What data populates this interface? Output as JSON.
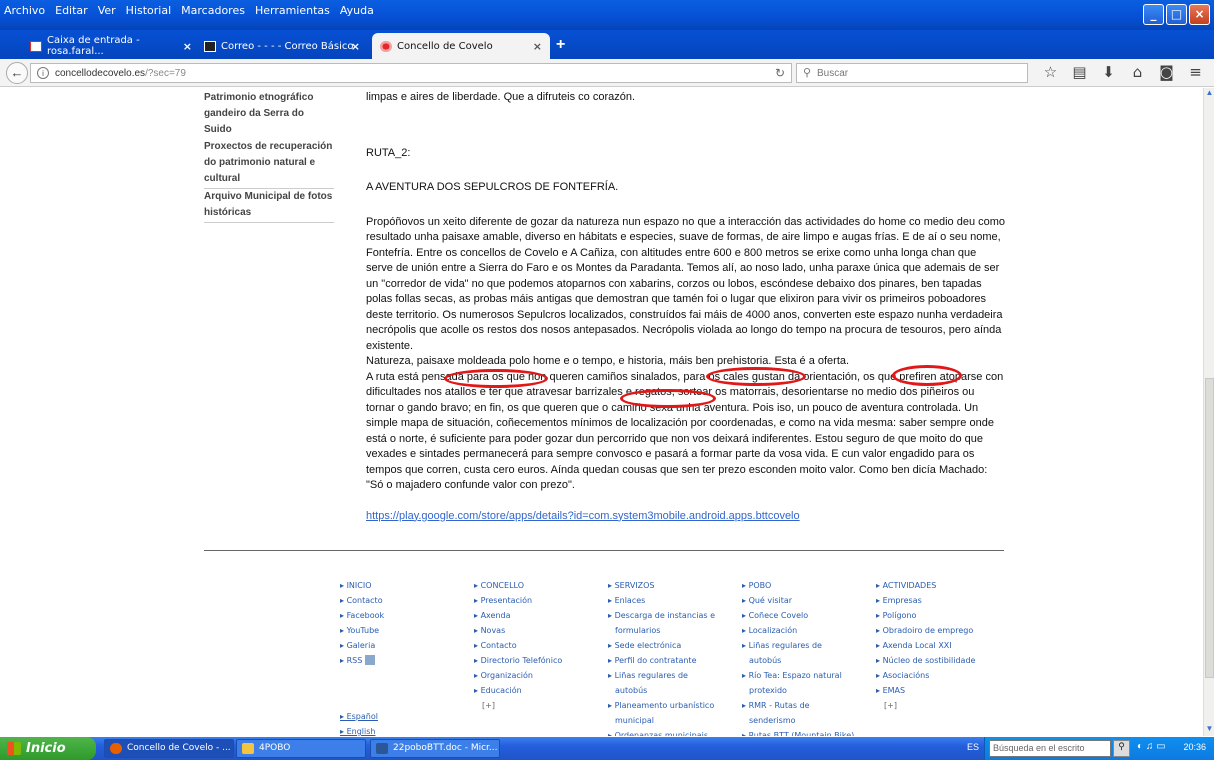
{
  "menu": [
    "Archivo",
    "Editar",
    "Ver",
    "Historial",
    "Marcadores",
    "Herramientas",
    "Ayuda"
  ],
  "window_controls": [
    "minimize-icon",
    "maximize-icon",
    "close-icon"
  ],
  "tabs": [
    {
      "label": "Caixa de entrada - rosa.faral...",
      "icon": "gmail-icon",
      "color": "#d93025"
    },
    {
      "label": "Correo - - - - Correo Básico",
      "icon": "mail-icon",
      "color": "#222222"
    },
    {
      "label": "Concello de Covelo",
      "icon": "covelo-icon",
      "color": "#e0282d"
    }
  ],
  "nav": {
    "url_host": "concellodecovelo.es",
    "url_path": "/?sec=79",
    "search_placeholder": "Buscar"
  },
  "sidebar": [
    "Patrimonio etnográfico gandeiro da Serra do Suido",
    "Proxectos de recuperación do patrimonio natural e cultural",
    "Arquivo Municipal de fotos históricas"
  ],
  "content": {
    "intro": "limpas e aires de liberdade. Que a difruteis co corazón.",
    "route": "RUTA_2:",
    "heading": "A AVENTURA DOS SEPULCROS DE FONTEFRÍA.",
    "body1": "Propóñovos un xeito diferente de gozar da natureza nun espazo no que a interacción das actividades do home co medio deu como resultado unha paisaxe amable, diverso en hábitats e especies, suave de formas, de aire limpo e augas frías. E de aí o seu nome, Fontefría. Entre os concellos de Covelo e A Cañiza, con altitudes entre 600 e 800 metros se erixe como unha longa chan que serve de unión entre a Sierra do Faro e os Montes da Paradanta. Temos alí, ao noso lado, unha paraxe única que ademais de ser un \"corredor de vida\" no que podemos atoparnos con xabarins, corzos ou lobos, escóndese debaixo dos pinares, ben tapadas polas follas secas, as probas máis antigas que demostran que tamén foi o lugar que elixiron para vivir os primeiros poboadores deste territorio. Os numerosos Sepulcros localizados, construídos fai máis de 4000 anos, converten este espazo nunha verdadeira necrópolis que acolle os restos dos nosos antepasados. Necrópolis violada ao longo do tempo na procura de tesouros, pero aínda existente.",
    "body2": "Natureza, paisaxe moldeada polo home e o tempo, e historia, máis ben prehistoria. Esta é a oferta.",
    "body3": "A ruta está pensada para os que non queren camiños sinalados, para os cales gustan da orientación, os que prefiren atoparse con dificultades nos atallos e ter que atravesar barrizales e regatos, sortear os matorrais, desorientarse no medio dos piñeiros ou tornar o gando bravo; en fin, os que queren que o camiño sexa unha aventura. Pois iso, un pouco de aventura controlada. Un simple mapa de situación, coñecementos mínimos de localización por coordenadas, e como na vida mesma: saber sempre onde está o norte, é suficiente para poder gozar dun percorrido que non vos deixará indiferentes. Estou seguro de que moito do que vexades e sintades permanecerá para sempre convosco e pasará a formar parte da vosa vida. E cun valor engadido para os tempos que corren, custa cero euros. Aínda quedan cousas que sen ter prezo esconden moito valor. Como ben dicía Machado: \"Só o majadero confunde valor con prezo\".",
    "link": "https://play.google.com/store/apps/details?id=com.system3mobile.android.apps.bttcovelo"
  },
  "footer": {
    "col1": [
      "INICIO",
      "Contacto",
      "Facebook",
      "YouTube",
      "Galeria",
      "RSS"
    ],
    "col2": [
      "CONCELLO",
      "Presentación",
      "Axenda",
      "Novas",
      "Contacto",
      "Directorio Telefónico",
      "Organización",
      "Educación",
      "[+]"
    ],
    "col3": [
      "SERVIZOS",
      "Enlaces",
      "Descarga de instancias e",
      "formularios",
      "Sede electrónica",
      "Perfil do contratante",
      "Liñas regulares de",
      "autobús",
      "Planeamento urbanístico",
      "municipal",
      "Ordenanzas municipais"
    ],
    "col4": [
      "POBO",
      "Qué visitar",
      "Coñece Covelo",
      "Localización",
      "Liñas regulares de",
      "autobús",
      "Río Tea: Espazo natural",
      "protexido",
      "RMR - Rutas de",
      "senderismo",
      "Rutas BTT (Mountain Bike)"
    ],
    "col5": [
      "ACTIVIDADES",
      "Empresas",
      "Polígono",
      "Obradoiro de emprego",
      "Axenda Local XXI",
      "Núcleo de sostibilidade",
      "Asociacións",
      "EMAS",
      "[+]"
    ],
    "lang": [
      "Español",
      "English"
    ]
  },
  "taskbar": {
    "start": "Inicio",
    "tasks": [
      {
        "label": "Concello de Covelo - ...",
        "icon": "firefox-icon",
        "color": "#e66000"
      },
      {
        "label": "4POBO",
        "icon": "folder-icon",
        "color": "#f5c542"
      },
      {
        "label": "22poboBTT.doc - Micr...",
        "icon": "word-icon",
        "color": "#2b5797"
      }
    ],
    "lang": "ES",
    "search_placeholder": "Búsqueda en el escrito",
    "clock": "20:36"
  }
}
